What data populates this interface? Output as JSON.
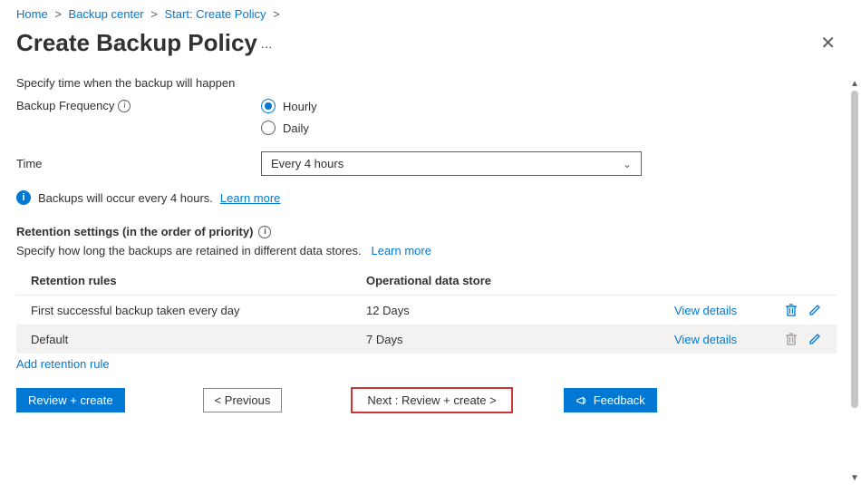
{
  "breadcrumb": {
    "home": "Home",
    "center": "Backup center",
    "start": "Start: Create Policy"
  },
  "page": {
    "title": "Create Backup Policy",
    "ellipsis": "···"
  },
  "form": {
    "specify_time": "Specify time when the backup will happen",
    "frequency_label": "Backup Frequency",
    "options": {
      "hourly": "Hourly",
      "daily": "Daily"
    },
    "selected": "hourly",
    "time_label": "Time",
    "time_value": "Every 4 hours",
    "info": "Backups will occur every 4 hours.",
    "learn_more": "Learn more"
  },
  "retention": {
    "heading": "Retention settings (in the order of priority)",
    "desc_prefix": "Specify how long the backups are retained in different data stores.",
    "learn_more": "Learn more",
    "columns": {
      "rules": "Retention rules",
      "store": "Operational data store"
    },
    "rows": [
      {
        "rule": "First successful backup taken every day",
        "store": "12 Days",
        "view": "View details"
      },
      {
        "rule": "Default",
        "store": "7 Days",
        "view": "View details"
      }
    ],
    "add": "Add retention rule"
  },
  "footer": {
    "review": "Review + create",
    "previous": "< Previous",
    "next": "Next : Review + create >",
    "feedback": "Feedback"
  }
}
